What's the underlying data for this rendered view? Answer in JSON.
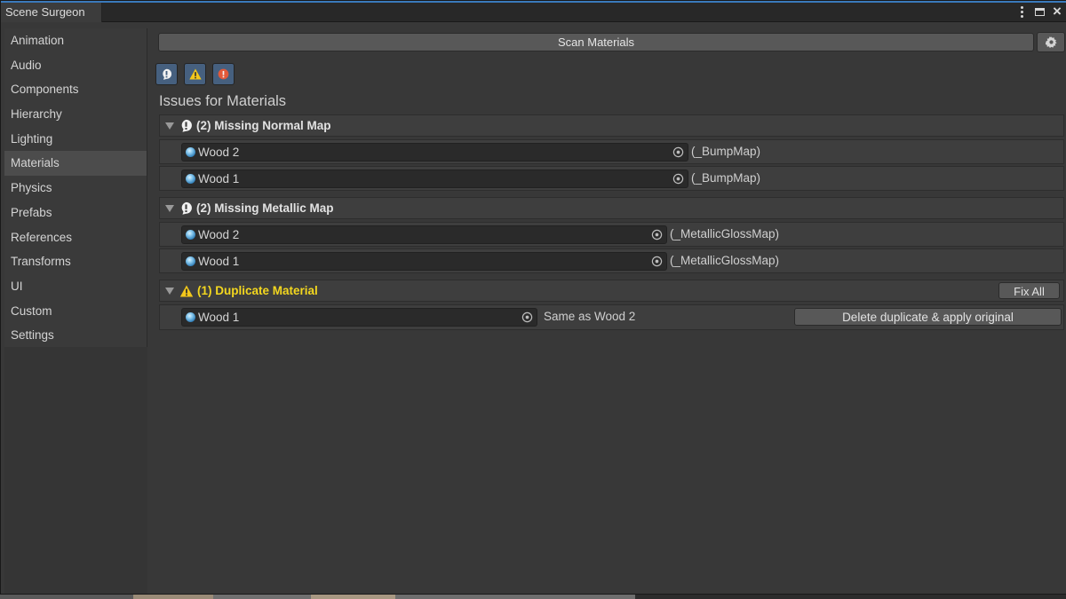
{
  "window": {
    "tab_title": "Scene Surgeon"
  },
  "sidebar": {
    "items": [
      {
        "label": "Animation"
      },
      {
        "label": "Audio"
      },
      {
        "label": "Components"
      },
      {
        "label": "Hierarchy"
      },
      {
        "label": "Lighting"
      },
      {
        "label": "Materials",
        "active": true
      },
      {
        "label": "Physics"
      },
      {
        "label": "Prefabs"
      },
      {
        "label": "References"
      },
      {
        "label": "Transforms"
      },
      {
        "label": "UI"
      },
      {
        "label": "Custom"
      },
      {
        "label": "Settings"
      }
    ]
  },
  "toolbar": {
    "scan_label": "Scan Materials",
    "settings_icon": "gear-icon"
  },
  "filters": [
    {
      "icon": "info-icon"
    },
    {
      "icon": "warning-icon"
    },
    {
      "icon": "error-icon"
    }
  ],
  "main": {
    "section_title": "Issues for Materials",
    "groups": [
      {
        "label": "(2) Missing Normal Map",
        "severity": "info",
        "items": [
          {
            "material": "Wood 2",
            "property": "(_BumpMap)"
          },
          {
            "material": "Wood 1",
            "property": "(_BumpMap)"
          }
        ]
      },
      {
        "label": "(2) Missing Metallic Map",
        "severity": "info",
        "items": [
          {
            "material": "Wood 2",
            "property": "(_MetallicGlossMap)"
          },
          {
            "material": "Wood 1",
            "property": "(_MetallicGlossMap)"
          }
        ]
      },
      {
        "label": "(1) Duplicate Material",
        "severity": "warning",
        "fix_all_label": "Fix All",
        "items": [
          {
            "material": "Wood 1",
            "property": "Same as Wood 2",
            "action_label": "Delete duplicate & apply original"
          }
        ]
      }
    ]
  },
  "colors": {
    "accent": "#3a79bb",
    "warning_text": "#f3d71f",
    "error": "#e3593a",
    "filter_bg": "#46607f"
  }
}
